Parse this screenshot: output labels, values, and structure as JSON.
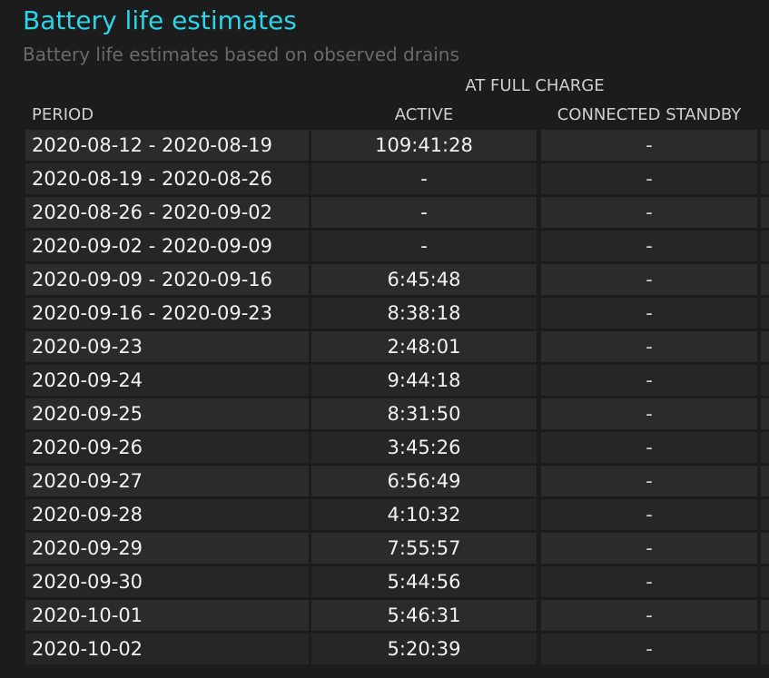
{
  "title": "Battery life estimates",
  "subtitle": "Battery life estimates based on observed drains",
  "group_header": "AT FULL CHARGE",
  "columns": {
    "period": "PERIOD",
    "active": "ACTIVE",
    "connected_standby": "CONNECTED STANDBY"
  },
  "rows": [
    {
      "period": "2020-08-12 - 2020-08-19",
      "active": "109:41:28",
      "standby": "-"
    },
    {
      "period": "2020-08-19 - 2020-08-26",
      "active": "-",
      "standby": "-"
    },
    {
      "period": "2020-08-26 - 2020-09-02",
      "active": "-",
      "standby": "-"
    },
    {
      "period": "2020-09-02 - 2020-09-09",
      "active": "-",
      "standby": "-"
    },
    {
      "period": "2020-09-09 - 2020-09-16",
      "active": "6:45:48",
      "standby": "-"
    },
    {
      "period": "2020-09-16 - 2020-09-23",
      "active": "8:38:18",
      "standby": "-"
    },
    {
      "period": "2020-09-23",
      "active": "2:48:01",
      "standby": "-"
    },
    {
      "period": "2020-09-24",
      "active": "9:44:18",
      "standby": "-"
    },
    {
      "period": "2020-09-25",
      "active": "8:31:50",
      "standby": "-"
    },
    {
      "period": "2020-09-26",
      "active": "3:45:26",
      "standby": "-"
    },
    {
      "period": "2020-09-27",
      "active": "6:56:49",
      "standby": "-"
    },
    {
      "period": "2020-09-28",
      "active": "4:10:32",
      "standby": "-"
    },
    {
      "period": "2020-09-29",
      "active": "7:55:57",
      "standby": "-"
    },
    {
      "period": "2020-09-30",
      "active": "5:44:56",
      "standby": "-"
    },
    {
      "period": "2020-10-01",
      "active": "5:46:31",
      "standby": "-"
    },
    {
      "period": "2020-10-02",
      "active": "5:20:39",
      "standby": "-"
    }
  ]
}
